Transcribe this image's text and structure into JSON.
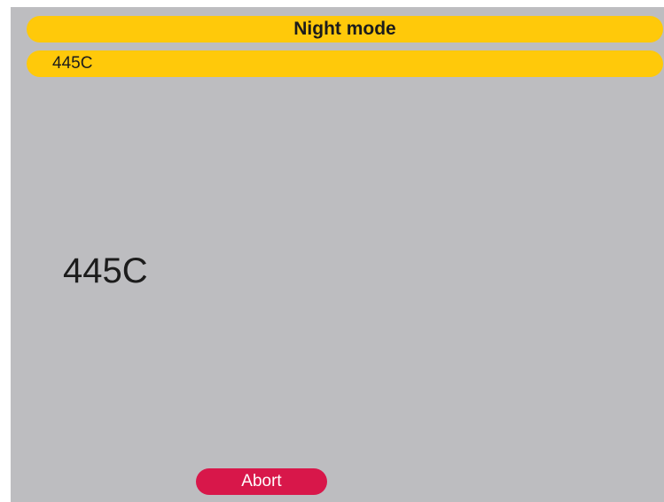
{
  "header": {
    "title": "Night mode"
  },
  "subheader": {
    "value": "445C"
  },
  "main": {
    "value": "445C"
  },
  "footer": {
    "abort_label": "Abort"
  },
  "colors": {
    "background": "#bdbdc0",
    "bar": "#ffc90a",
    "abort_button": "#d8174a"
  }
}
